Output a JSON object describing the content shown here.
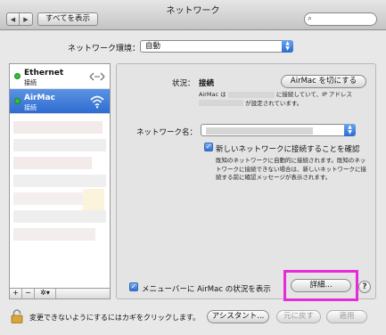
{
  "window": {
    "title": "ネットワーク"
  },
  "toolbar": {
    "back": "◀",
    "forward": "▶",
    "show_all": "すべてを表示",
    "search_placeholder": ""
  },
  "location": {
    "label": "ネットワーク環境：",
    "value": "自動"
  },
  "services": [
    {
      "name": "Ethernet",
      "status": "接続",
      "icon": "ethernet-icon",
      "selected": false
    },
    {
      "name": "AirMac",
      "status": "接続",
      "icon": "wifi-icon",
      "selected": true
    }
  ],
  "sidebar_bar": {
    "add": "+",
    "remove": "−",
    "action": "✲▾"
  },
  "detail": {
    "status_label": "状況：",
    "status_value": "接続",
    "turn_off_button": "AirMac を切にする",
    "status_desc_1a": "AirMac は",
    "status_desc_1b": "に接続していて、IP アドレス",
    "status_desc_2": "が設定されています。",
    "network_name_label": "ネットワーク名：",
    "ask_checkbox_label": "新しいネットワークに接続することを確認",
    "ask_desc": "既知のネットワークに自動的に接続されます。既知のネットワークに接続できない場合は、新しいネットワークに接続する前に確認メッセージが表示されます。",
    "menubar_checkbox_label": "メニューバーに AirMac の状況を表示",
    "advanced_button": "詳細...",
    "help": "?"
  },
  "footer": {
    "lock_text": "変更できないようにするにはカギをクリックします。",
    "assist_button": "アシスタント...",
    "revert_button": "元に戻す",
    "apply_button": "適用"
  },
  "colors": {
    "accent": "#2f6cd1",
    "status_green": "#36c036",
    "highlight": "#e62bd9"
  }
}
